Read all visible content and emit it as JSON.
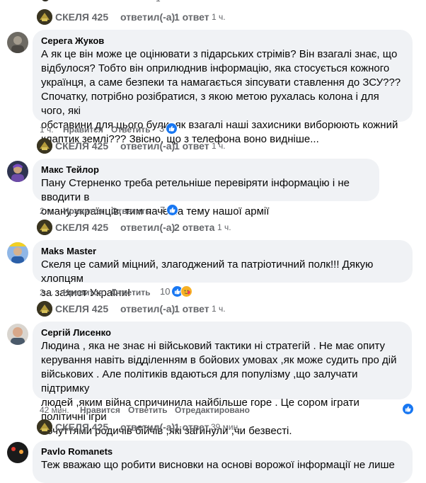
{
  "colors": {
    "accent": "#1877f2",
    "meta": "#65676b",
    "bubble": "#f0f2f5"
  },
  "top_reply": {
    "author": "СКЕЛЯ 425",
    "text": "ответил(-а)",
    "dot": "·",
    "count": "1 ответ",
    "time": "1 ч.",
    "partial_count": "1"
  },
  "comments": [
    {
      "author": "Серега Жуков",
      "lines": [
        "А як це він може це оцінювати з підарських стрімів? Він взагалі знає, що",
        "відбулося? Тобто він оприлюднив інформацію, яка стосується кожного",
        "українця, а саме безпеки та намагається зіпсувати ставлення до ЗСУ???",
        "Спочатку, потрібно розібратися, з якою метою рухалась колона і для чого, які",
        "обставини для цього були, як взагалі наші захисники виборюють кожний",
        "клаптик землі??? Звісно, що з телефона воно видніше..."
      ],
      "time": "1 ч.",
      "like": "Нравится",
      "reply": "Ответить",
      "reactions": "3",
      "reply_row": {
        "author": "СКЕЛЯ 425",
        "text": "ответил(-а)",
        "dot": "·",
        "count": "1 ответ",
        "time": "1 ч."
      }
    },
    {
      "author": "Макс Тейлор",
      "lines": [
        "Пану Стерненко треба ретельніше перевіряти інформацію і не вводити в",
        "оману українців, тим паче на тему нашої армії"
      ],
      "time": "2 ч.",
      "like": "Нравится",
      "reply": "Ответить",
      "reactions": "7",
      "reply_row": {
        "author": "СКЕЛЯ 425",
        "text": "ответил(-а)",
        "dot": "·",
        "count": "2 ответа",
        "time": "1 ч."
      }
    },
    {
      "author": "Maks Master",
      "lines": [
        "Скеля це самий міцний, злагоджений та патріотичний полк!!! Дякую хлопцям",
        "за захист України!"
      ],
      "time": "2 ч.",
      "like": "Нравится",
      "reply": "Ответить",
      "reactions": "10",
      "reply_row": {
        "author": "СКЕЛЯ 425",
        "text": "ответил(-а)",
        "dot": "·",
        "count": "1 ответ",
        "time": "1 ч."
      }
    },
    {
      "author": "Сергій Лисенко",
      "lines": [
        "Людина , яка не знає ні військовий тактики ні стратегій . Не має опиту",
        "керування навіть відділенням в бойових умовах ,як може судить про дій",
        "військових . Але політиків вдаються для популізму ,що залучати підтримку",
        "людей ,яким війна спричинила найбільше горе . Це сором іграти політичні ігри",
        "почуттями родичів бійчів ,які загинули ,чи безвесті."
      ],
      "time": "42 мин.",
      "like": "Нравится",
      "reply": "Ответить",
      "edited": "Отредактировано",
      "reply_row": {
        "author": "СКЕЛЯ 425",
        "text": "ответил(-а)",
        "dot": "·",
        "count": "1 ответ",
        "time": "39 мин."
      }
    },
    {
      "author": "Pavlo Romanets",
      "lines": [
        "Теж вважаю що робити висновки на основі ворожої інформації не лише"
      ]
    }
  ],
  "icons": {
    "like_badge": "thumbs-up-icon",
    "love_badge": "care-icon",
    "reply_arrow": "reply-arrow-icon"
  }
}
